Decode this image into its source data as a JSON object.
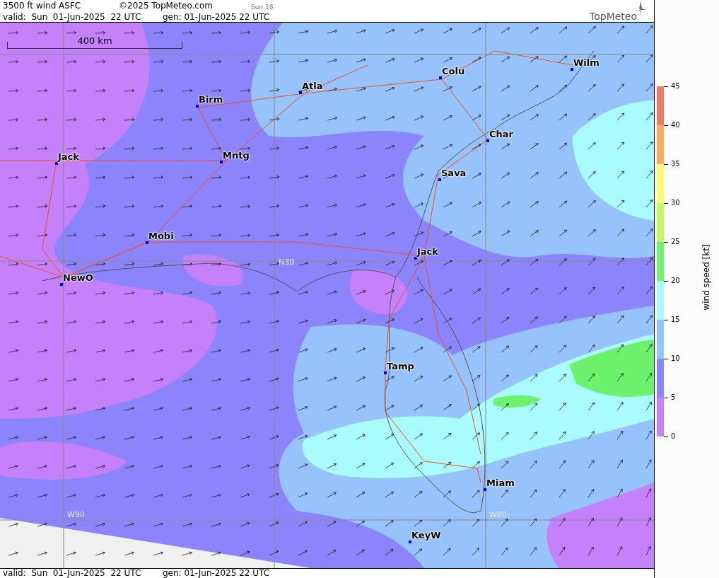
{
  "header": {
    "title": "3500 ft wind ASFC",
    "copyright": "©2025 TopMeteo.com",
    "run": "Sun 18",
    "valid": "valid:  Sun  01-Jun-2025  22 UTC",
    "generated": "gen: 01-Jun-2025 22 UTC",
    "logo": "TopMeteo"
  },
  "map": {
    "scale": "400 km",
    "grid_labels": [
      "W90",
      "W80",
      "N30"
    ],
    "cities": [
      "Birm",
      "Atla",
      "Colu",
      "Wilm",
      "Jack",
      "Mntg",
      "Char",
      "Sava",
      "Mobi",
      "Jack",
      "NewO",
      "Tamp",
      "Miam",
      "KeyW"
    ]
  },
  "legend": {
    "title": "wind speed [kt]",
    "ticks": [
      "45",
      "40",
      "35",
      "30",
      "25",
      "20",
      "15",
      "10",
      "5",
      "0"
    ],
    "bands": [
      {
        "color": "#ee7a66"
      },
      {
        "color": "#fcaa60"
      },
      {
        "color": "#fcfc6c"
      },
      {
        "color": "#c0fa60"
      },
      {
        "color": "#6cf26c"
      },
      {
        "color": "#aafcfc"
      },
      {
        "color": "#96c3fc"
      },
      {
        "color": "#8c84fc"
      },
      {
        "color": "#c580fc"
      }
    ]
  },
  "footer": {
    "valid": "valid:  Sun  01-Jun-2025  22 UTC",
    "generated": "gen: 01-Jun-2025 22 UTC"
  }
}
